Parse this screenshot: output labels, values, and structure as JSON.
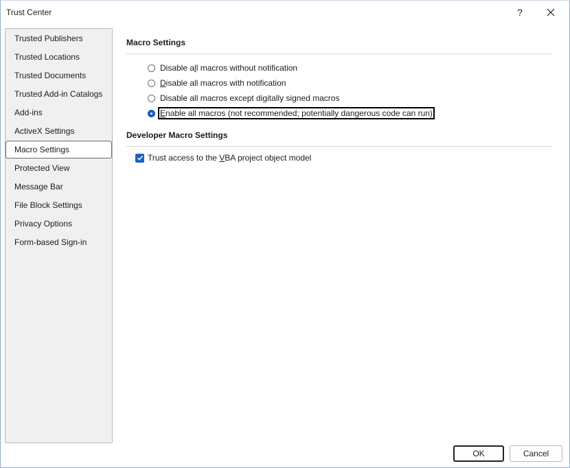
{
  "window": {
    "title": "Trust Center",
    "help_glyph": "?",
    "close_glyph": "✕"
  },
  "sidebar": {
    "items": [
      {
        "label": "Trusted Publishers",
        "selected": false
      },
      {
        "label": "Trusted Locations",
        "selected": false
      },
      {
        "label": "Trusted Documents",
        "selected": false
      },
      {
        "label": "Trusted Add-in Catalogs",
        "selected": false
      },
      {
        "label": "Add-ins",
        "selected": false
      },
      {
        "label": "ActiveX Settings",
        "selected": false
      },
      {
        "label": "Macro Settings",
        "selected": true
      },
      {
        "label": "Protected View",
        "selected": false
      },
      {
        "label": "Message Bar",
        "selected": false
      },
      {
        "label": "File Block Settings",
        "selected": false
      },
      {
        "label": "Privacy Options",
        "selected": false
      },
      {
        "label": "Form-based Sign-in",
        "selected": false
      }
    ]
  },
  "macro_settings": {
    "heading": "Macro Settings",
    "options": [
      {
        "label_pre": "Disable a",
        "accel": "l",
        "label_post": "l macros without notification",
        "checked": false
      },
      {
        "label_pre": "",
        "accel": "D",
        "label_post": "isable all macros with notification",
        "checked": false
      },
      {
        "label_pre": "Disable all macros except di",
        "accel": "g",
        "label_post": "itally signed macros",
        "checked": false
      },
      {
        "label_pre": "",
        "accel": "E",
        "label_post": "nable all macros (not recommended; potentially dangerous code can run)",
        "checked": true
      }
    ]
  },
  "developer_settings": {
    "heading": "Developer Macro Settings",
    "trust_vba": {
      "label_pre": "Trust access to the ",
      "accel": "V",
      "label_post": "BA project object model",
      "checked": true
    }
  },
  "buttons": {
    "ok": "OK",
    "cancel": "Cancel"
  },
  "colors": {
    "accent": "#1a62c4",
    "selected_border": "#6b6b6b",
    "sidebar_bg": "#f0f0f0"
  }
}
